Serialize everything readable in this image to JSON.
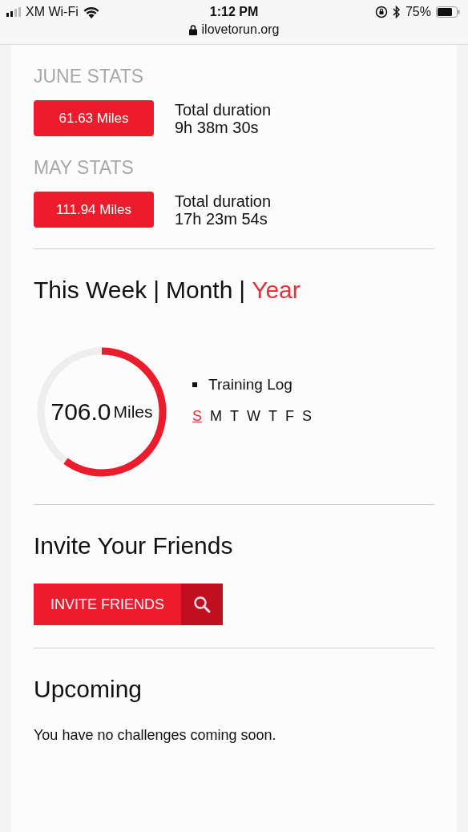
{
  "status_bar": {
    "carrier": "XM Wi-Fi",
    "time": "1:12 PM",
    "battery": "75%",
    "url": "ilovetorun.org"
  },
  "month_stats": [
    {
      "heading": "JUNE STATS",
      "distance": "61.63 Miles",
      "duration_label": "Total duration",
      "duration": "9h 38m 30s"
    },
    {
      "heading": "MAY STATS",
      "distance": "111.94 Miles",
      "duration_label": "Total duration",
      "duration": "17h 23m 54s"
    }
  ],
  "period_tabs": [
    {
      "label": "This Week",
      "selected": false
    },
    {
      "label": "Month",
      "selected": false
    },
    {
      "label": "Year",
      "selected": true
    }
  ],
  "separator": "|",
  "progress": {
    "value": "706.0",
    "unit": "Miles"
  },
  "training_log": {
    "label": "Training Log",
    "days": [
      {
        "label": "S",
        "selected": true
      },
      {
        "label": "M",
        "selected": false
      },
      {
        "label": "T",
        "selected": false
      },
      {
        "label": "W",
        "selected": false
      },
      {
        "label": "T",
        "selected": false
      },
      {
        "label": "F",
        "selected": false
      },
      {
        "label": "S",
        "selected": false
      }
    ]
  },
  "invite": {
    "heading": "Invite Your Friends",
    "button": "INVITE FRIENDS"
  },
  "upcoming": {
    "heading": "Upcoming",
    "message": "You have no challenges coming soon."
  }
}
